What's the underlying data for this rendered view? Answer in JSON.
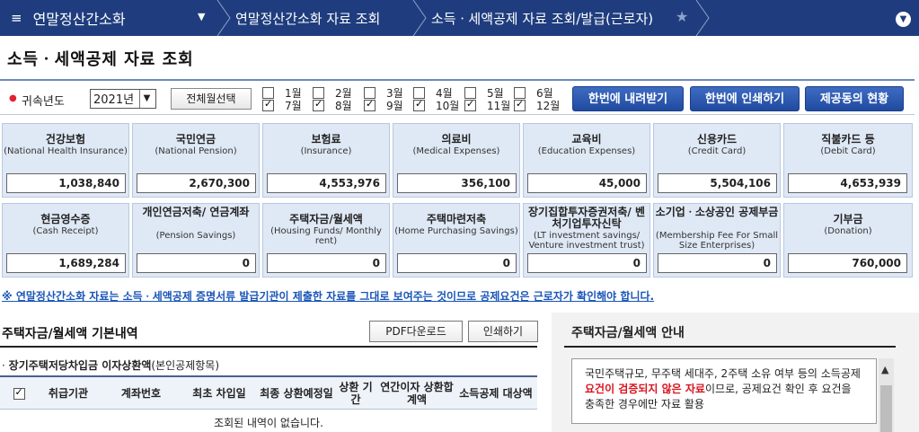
{
  "nav": {
    "menu_title": "연말정산간소화",
    "crumb1": "연말정산간소화 자료 조회",
    "crumb2": "소득ㆍ세액공제 자료 조회/발급(근로자)"
  },
  "page_title": "소득ㆍ세액공제 자료 조회",
  "filter": {
    "year_label": "귀속년도",
    "year_value": "2021년",
    "select_all": "전체월선택",
    "months": [
      {
        "label": "1월",
        "checked": false
      },
      {
        "label": "2월",
        "checked": false
      },
      {
        "label": "3월",
        "checked": false
      },
      {
        "label": "4월",
        "checked": false
      },
      {
        "label": "5월",
        "checked": false
      },
      {
        "label": "6월",
        "checked": false
      },
      {
        "label": "7월",
        "checked": true
      },
      {
        "label": "8월",
        "checked": true
      },
      {
        "label": "9월",
        "checked": true
      },
      {
        "label": "10월",
        "checked": true
      },
      {
        "label": "11월",
        "checked": true
      },
      {
        "label": "12월",
        "checked": true
      }
    ],
    "btn_download": "한번에 내려받기",
    "btn_print": "한번에 인쇄하기",
    "btn_consent": "제공동의 현황"
  },
  "cards": [
    {
      "ko": "건강보험",
      "en": "(National Health Insurance)",
      "value": "1,038,840"
    },
    {
      "ko": "국민연금",
      "en": "(National Pension)",
      "value": "2,670,300"
    },
    {
      "ko": "보험료",
      "en": "(Insurance)",
      "value": "4,553,976"
    },
    {
      "ko": "의료비",
      "en": "(Medical Expenses)",
      "value": "356,100"
    },
    {
      "ko": "교육비",
      "en": "(Education Expenses)",
      "value": "45,000"
    },
    {
      "ko": "신용카드",
      "en": "(Credit Card)",
      "value": "5,504,106"
    },
    {
      "ko": "직불카드 등",
      "en": "(Debit Card)",
      "value": "4,653,939"
    },
    {
      "ko": "현금영수증",
      "en": "(Cash Receipt)",
      "value": "1,689,284"
    },
    {
      "ko": "개인연금저축/ 연금계좌",
      "en": "(Pension Savings)",
      "value": "0"
    },
    {
      "ko": "주택자금/월세액",
      "en": "(Housing Funds/ Monthly rent)",
      "value": "0"
    },
    {
      "ko": "주택마련저축",
      "en": "(Home Purchasing Savings)",
      "value": "0"
    },
    {
      "ko": "장기집합투자증권저축/ 벤처기업투자신탁",
      "en": "(LT investment savings/ Venture investment trust)",
      "value": "0"
    },
    {
      "ko": "소기업ㆍ소상공인 공제부금",
      "en": "(Membership Fee For Small Size Enterprises)",
      "value": "0"
    },
    {
      "ko": "기부금",
      "en": "(Donation)",
      "value": "760,000"
    }
  ],
  "notice": "※ 연말정산간소화 자료는 소득ㆍ세액공제 증명서류 발급기관이 제출한 자료를 그대로 보여주는 것이므로 공제요건은 근로자가 확인해야 합니다.",
  "housing": {
    "title": "주택자금/월세액 기본내역",
    "btn_pdf": "PDF다운로드",
    "btn_print": "인쇄하기",
    "sub_bold": "장기주택저당차입금 이자상환액",
    "sub_rest": "(본인공제항목)",
    "columns": [
      "취급기관",
      "계좌번호",
      "최초 차입일",
      "최종 상환예정일",
      "상환 기간",
      "연간이자 상환합계액",
      "소득공제 대상액"
    ],
    "empty_text": "조회된 내역이 없습니다."
  },
  "guide": {
    "title": "주택자금/월세액 안내",
    "text_a": "국민주택규모, 무주택 세대주, 2주택 소유 여부 등의 소득공제 ",
    "text_red": "요건이 검증되지 않은 자료",
    "text_b": "이므로, 공제요건 확인 후 요건을 충족한 경우에만 자료 활용"
  }
}
